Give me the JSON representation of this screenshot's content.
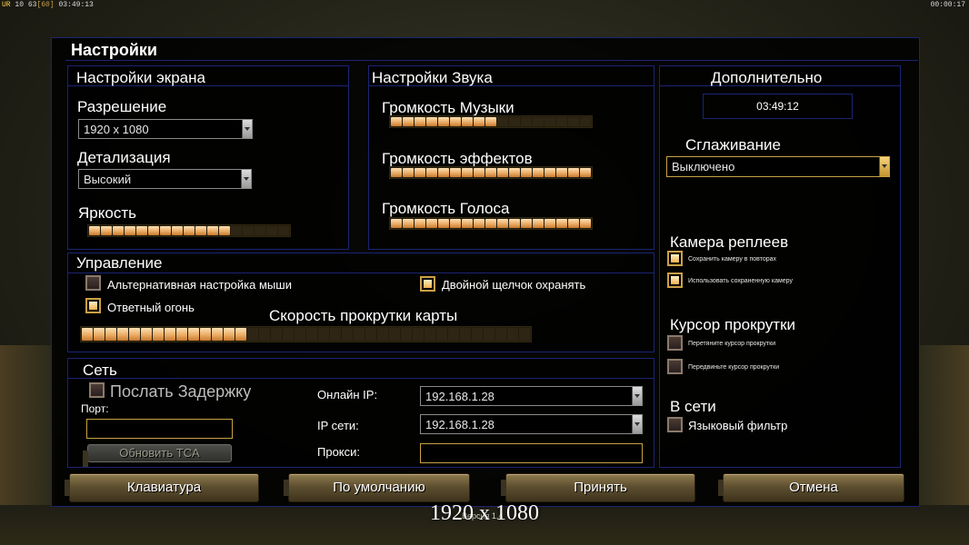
{
  "hud": {
    "left_tag": "UR",
    "left_nums": "10 63",
    "left_bracket": "[60]",
    "left_time": "03:49:13",
    "right_time": "00:00:17"
  },
  "title": "Настройки",
  "screen": {
    "title": "Настройки экрана",
    "resolution_label": "Разрешение",
    "resolution_value": "1920 x 1080",
    "detail_label": "Детализация",
    "detail_value": "Высокий",
    "brightness_label": "Яркость",
    "brightness_level": 12,
    "brightness_max": 17
  },
  "sound": {
    "title": "Настройки Звука",
    "music_label": "Громкость Музыки",
    "music_level": 9,
    "music_max": 17,
    "effects_label": "Громкость эффектов",
    "effects_level": 17,
    "effects_max": 17,
    "voice_label": "Громкость Голоса",
    "voice_level": 17,
    "voice_max": 17
  },
  "extra": {
    "title": "Дополнительно",
    "clock": "03:49:12",
    "aa_label": "Сглаживание",
    "aa_value": "Выключено",
    "replay_title": "Камера реплеев",
    "replay_save": "Сохранить камеру в повторах",
    "replay_use": "Использовать сохраненную камеру",
    "replay_save_on": true,
    "replay_use_on": true,
    "cursor_title": "Курсор прокрутки",
    "cursor_drag": "Перетяните курсор прокрутки",
    "cursor_move": "Передвиньте курсор прокрутки",
    "cursor_drag_on": false,
    "cursor_move_on": false,
    "online_title": "В сети",
    "lang_filter": "Языковый фильтр",
    "lang_filter_on": false
  },
  "control": {
    "title": "Управление",
    "alt_mouse": "Альтернативная настройка мыши",
    "alt_mouse_on": false,
    "double_click": "Двойной щелчок охранять",
    "double_click_on": true,
    "return_fire": "Ответный огонь",
    "return_fire_on": true,
    "scroll_label": "Скорость прокрутки карты",
    "scroll_level": 14,
    "scroll_max": 38
  },
  "network": {
    "title": "Сеть",
    "send_delay": "Послать Задержку",
    "send_delay_on": false,
    "port_label": "Порт:",
    "port_value": "",
    "update_tca": "Обновить TCA",
    "online_ip_label": "Онлайн IP:",
    "online_ip_value": "192.168.1.28",
    "lan_ip_label": "IP сети:",
    "lan_ip_value": "192.168.1.28",
    "proxy_label": "Прокси:",
    "proxy_value": ""
  },
  "buttons": {
    "keyboard": "Клавиатура",
    "defaults": "По умолчанию",
    "accept": "Принять",
    "cancel": "Отмена"
  },
  "status": "1920 x 1080",
  "version": "Версия 1.4"
}
